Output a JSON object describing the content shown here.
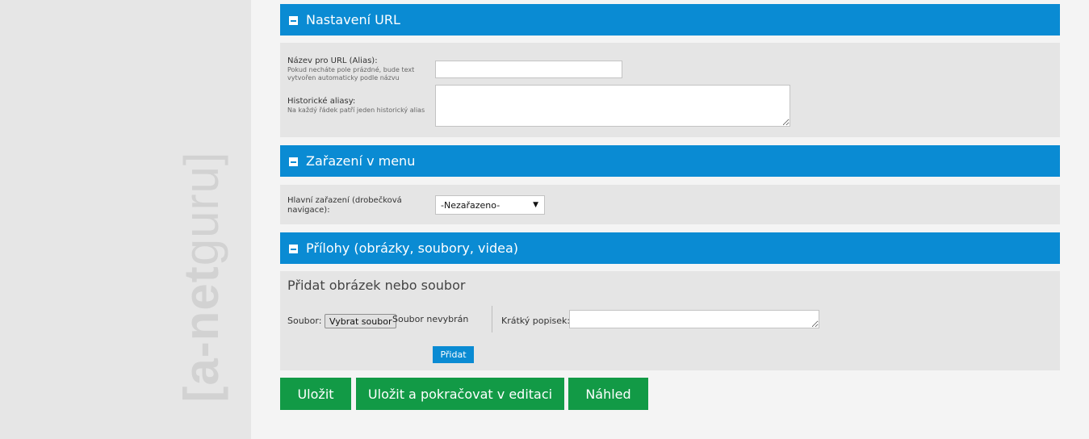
{
  "logo": {
    "text_bold": "[a-net",
    "text_regular": "guru]"
  },
  "sections": {
    "url": {
      "title": "Nastavení URL",
      "alias_label": "Název pro URL (Alias):",
      "alias_hint": "Pokud necháte pole prázdné, bude text vytvořen automaticky podle názvu",
      "alias_value": "",
      "historic_label": "Historické aliasy:",
      "historic_hint": "Na každý řádek patří jeden historický alias",
      "historic_value": ""
    },
    "menu": {
      "title": "Zařazení v menu",
      "main_label": "Hlavní zařazení (drobečková navigace):",
      "main_selected": "-Nezařazeno-"
    },
    "attachments": {
      "title": "Přílohy (obrázky, soubory, videa)",
      "add_title": "Přidat obrázek nebo soubor",
      "file_label": "Soubor:",
      "file_button": "Vybrat soubor",
      "file_status": "Soubor nevybrán",
      "description_label": "Krátký popisek:",
      "description_value": "",
      "add_button": "Přidat"
    }
  },
  "actions": {
    "save": "Uložit",
    "save_continue": "Uložit a pokračovat v editaci",
    "preview": "Náhled"
  },
  "colors": {
    "header_blue": "#0a8bd3",
    "button_green": "#129a46",
    "panel_gray": "#e5e5e5"
  }
}
